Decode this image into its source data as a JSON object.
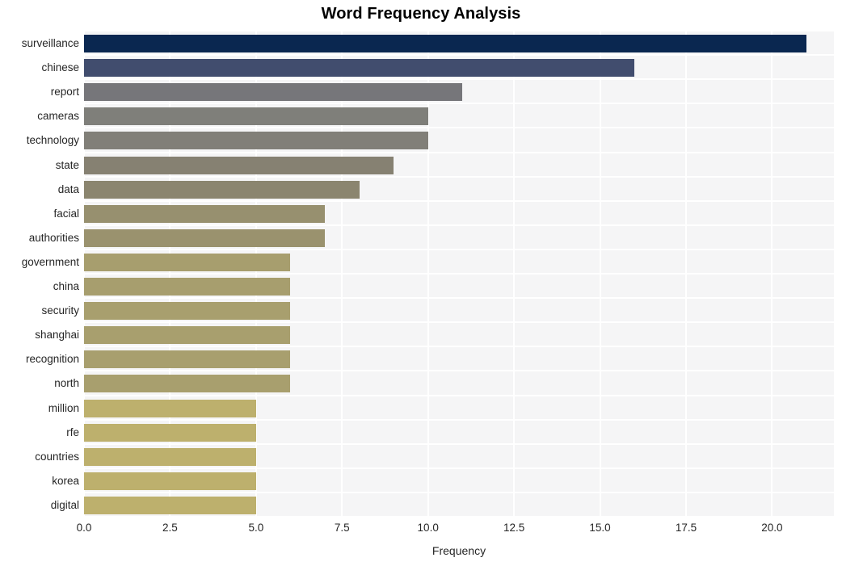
{
  "chart_data": {
    "type": "bar",
    "orientation": "horizontal",
    "title": "Word Frequency Analysis",
    "xlabel": "Frequency",
    "ylabel": "",
    "categories": [
      "surveillance",
      "chinese",
      "report",
      "cameras",
      "technology",
      "state",
      "data",
      "facial",
      "authorities",
      "government",
      "china",
      "security",
      "shanghai",
      "recognition",
      "north",
      "million",
      "rfe",
      "countries",
      "korea",
      "digital"
    ],
    "values": [
      21,
      16,
      11,
      10,
      10,
      9,
      8,
      7,
      7,
      6,
      6,
      6,
      6,
      6,
      6,
      5,
      5,
      5,
      5,
      5
    ],
    "bar_colors": [
      "#0a2750",
      "#414d6e",
      "#76767a",
      "#7f7f7a",
      "#817f78",
      "#868172",
      "#8b856f",
      "#97906f",
      "#9a926e",
      "#a79e6e",
      "#a79e6e",
      "#a89f6e",
      "#a89f6e",
      "#a89f6e",
      "#a89f6e",
      "#bdb06d",
      "#bdb06d",
      "#bdb06d",
      "#bdb06d",
      "#bdb06d"
    ],
    "xlim": [
      0,
      21.8
    ],
    "xticks": [
      0,
      2.5,
      5,
      7.5,
      10,
      12.5,
      15,
      17.5,
      20
    ],
    "xticklabels": [
      "0.0",
      "2.5",
      "5.0",
      "7.5",
      "10.0",
      "12.5",
      "15.0",
      "17.5",
      "20.0"
    ],
    "grid": true,
    "grid_color": "#ffffff",
    "plot_background": "#f5f5f6",
    "legend": null
  }
}
